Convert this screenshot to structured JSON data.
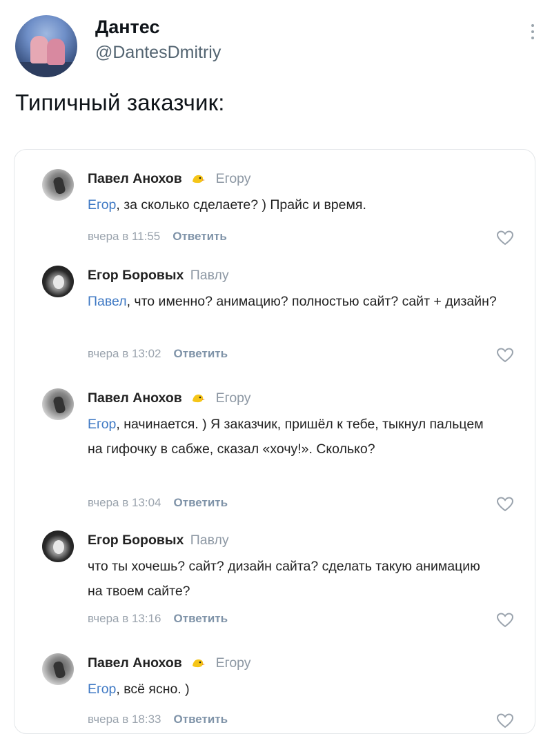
{
  "tweet": {
    "author_name": "Дантес",
    "author_handle": "@DantesDmitriy",
    "text": "Типичный заказчик:"
  },
  "comments": [
    {
      "author": "Павел Анохов",
      "reply_to": "Егору",
      "mention": "Егор",
      "text": ", за сколько сделаете? ) Прайс и время.",
      "time": "вчера в 11:55",
      "answer_label": "Ответить",
      "avatar_icon": "bird-avatar-icon"
    },
    {
      "author": "Егор Боровых",
      "reply_to": "Павлу",
      "mention": "Павел",
      "text": ", что именно? анимацию? полностью сайт? сайт + дизайн?",
      "time": "вчера в 13:02",
      "answer_label": "Ответить",
      "avatar_icon": "portrait-avatar-icon"
    },
    {
      "author": "Павел Анохов",
      "reply_to": "Егору",
      "mention": "Егор",
      "text": ", начинается. ) Я заказчик, пришёл к тебе, тыкнул пальцем на гифочку в сабже, сказал «хочу!». Сколько?",
      "time": "вчера в 13:04",
      "answer_label": "Ответить",
      "avatar_icon": "bird-avatar-icon"
    },
    {
      "author": "Егор Боровых",
      "reply_to": "Павлу",
      "mention": "",
      "text": "что ты хочешь? сайт? дизайн сайта? сделать такую анимацию на твоем сайте?",
      "time": "вчера в 13:16",
      "answer_label": "Ответить",
      "avatar_icon": "portrait-avatar-icon"
    },
    {
      "author": "Павел Анохов",
      "reply_to": "Егору",
      "mention": "Егор",
      "text": ", всё ясно. )",
      "time": "вчера в 18:33",
      "answer_label": "Ответить",
      "avatar_icon": "bird-avatar-icon"
    }
  ],
  "colors": {
    "mention": "#3f79c4",
    "meta": "#9aa3ad",
    "emoji": "#f5c518"
  }
}
